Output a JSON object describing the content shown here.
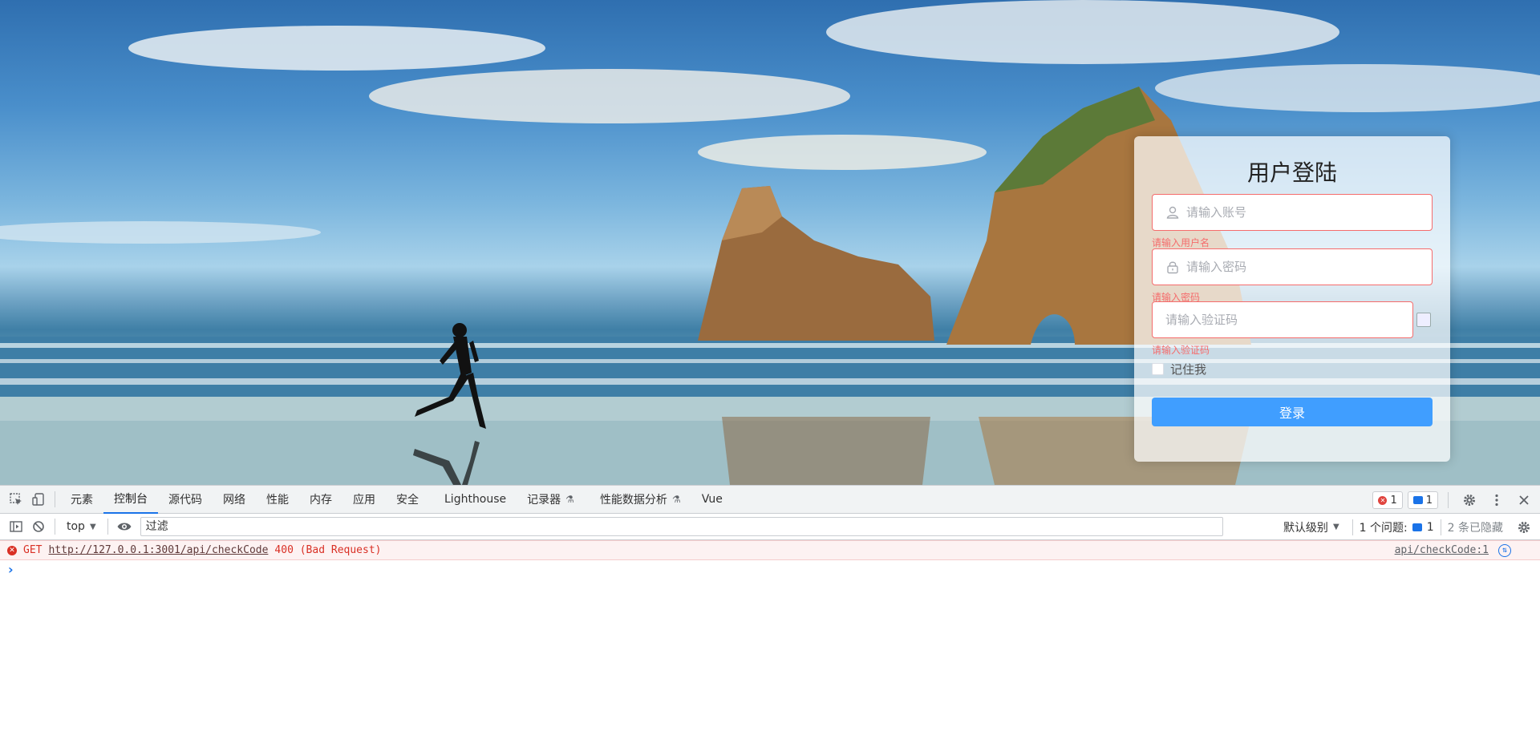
{
  "login": {
    "title": "用户登陆",
    "username_placeholder": "请输入账号",
    "username_error": "请输入用户名",
    "password_placeholder": "请输入密码",
    "password_error": "请输入密码",
    "code_placeholder": "请输入验证码",
    "code_error": "请输入验证码",
    "remember_label": "记住我",
    "submit_label": "登录",
    "error_color": "#f56c6c",
    "button_color": "#409eff"
  },
  "devtools": {
    "tabs": [
      {
        "label": "元素"
      },
      {
        "label": "控制台"
      },
      {
        "label": "源代码"
      },
      {
        "label": "网络"
      },
      {
        "label": "性能"
      },
      {
        "label": "内存"
      },
      {
        "label": "应用"
      },
      {
        "label": "安全"
      },
      {
        "label": "Lighthouse"
      },
      {
        "label": "记录器"
      },
      {
        "label": "性能数据分析"
      },
      {
        "label": "Vue"
      }
    ],
    "active_tab": "控制台",
    "error_count": "1",
    "message_count": "1",
    "context": "top",
    "filter_placeholder": "过滤",
    "level_label": "默认级别",
    "issues_label": "1 个问题:",
    "issues_count": "1",
    "hidden_label": "2 条已隐藏",
    "console": {
      "method": "GET",
      "url": "http://127.0.0.1:3001/api/checkCode",
      "status": "400 (Bad Request)",
      "source": "api/checkCode:1"
    }
  }
}
